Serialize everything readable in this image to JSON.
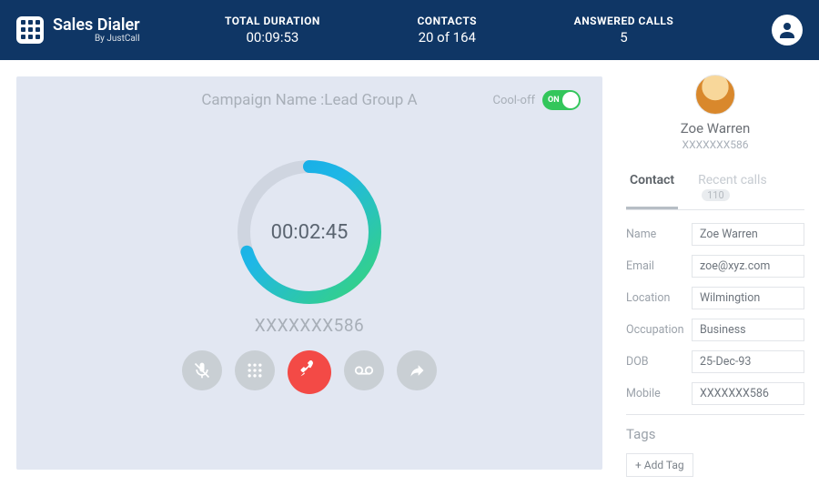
{
  "header": {
    "brand_title": "Sales Dialer",
    "brand_sub": "By JustCall",
    "duration_label": "TOTAL DURATION",
    "duration_value": "00:09:53",
    "contacts_label": "CONTACTS",
    "contacts_value": "20 of 164",
    "answered_label": "ANSWERED CALLS",
    "answered_value": "5"
  },
  "call": {
    "campaign_prefix": "Campaign Name : ",
    "campaign_name": "Lead Group A",
    "cooloff_label": "Cool-off",
    "switch_text": "ON",
    "timer": "00:02:45",
    "number_masked": "XXXXXXX586",
    "progress_percent": 70
  },
  "contact": {
    "name": "Zoe Warren",
    "number_masked": "XXXXXXX586",
    "tabs": {
      "contact": "Contact",
      "recent": "Recent calls",
      "recent_count": "110"
    },
    "fields": [
      {
        "label": "Name",
        "value": "Zoe Warren"
      },
      {
        "label": "Email",
        "value": "zoe@xyz.com"
      },
      {
        "label": "Location",
        "value": "Wilmingtion"
      },
      {
        "label": "Occupation",
        "value": "Business"
      },
      {
        "label": "DOB",
        "value": "25-Dec-93"
      },
      {
        "label": "Mobile",
        "value": "XXXXXXX586"
      }
    ],
    "tags_title": "Tags",
    "add_tag": "+ Add Tag"
  },
  "icons": {
    "mute": "mute-icon",
    "dialpad": "dialpad-icon",
    "hangup": "hangup-icon",
    "voicemail": "voicemail-icon",
    "forward": "forward-icon",
    "profile": "profile-icon"
  }
}
